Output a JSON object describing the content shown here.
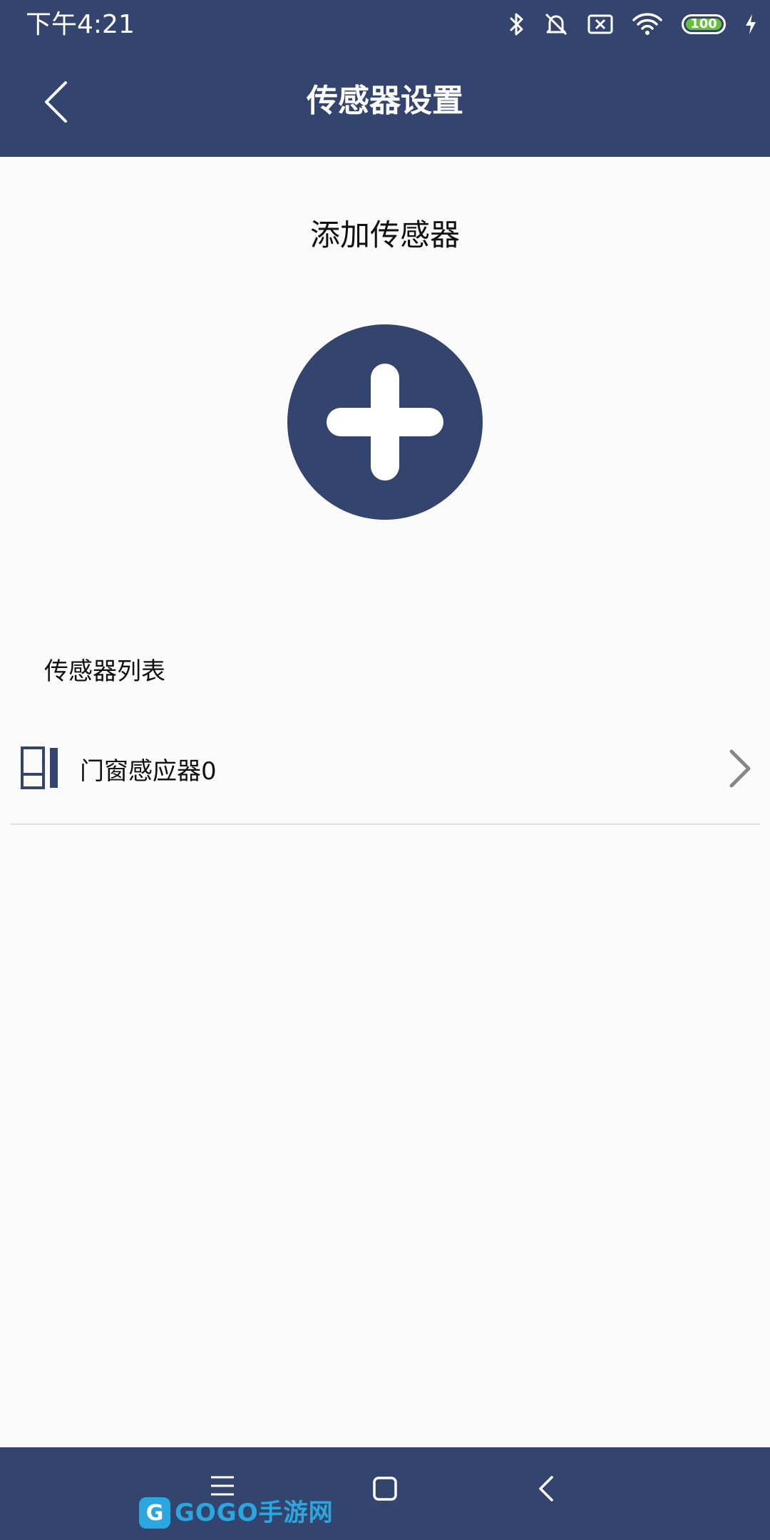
{
  "status_bar": {
    "time": "下午4:21",
    "battery": "100",
    "icons": [
      "bluetooth-icon",
      "mute-alarm-icon",
      "no-sim-icon",
      "wifi-icon",
      "battery-icon",
      "charging-icon"
    ]
  },
  "header": {
    "title": "传感器设置",
    "back_icon": "chevron-left-icon"
  },
  "add_section": {
    "title": "添加传感器",
    "button_icon": "plus-icon"
  },
  "list_section": {
    "title": "传感器列表",
    "items": [
      {
        "label": "门窗感应器0",
        "icon": "door-window-sensor-icon"
      }
    ]
  },
  "nav_bar": {
    "icons": [
      "menu-icon",
      "home-icon",
      "back-icon"
    ]
  },
  "watermark": {
    "text": "GOGO手游网"
  },
  "colors": {
    "primary": "#33446f",
    "background": "#fbfbfb",
    "divider": "#e2e2e2",
    "battery": "#63c23a"
  }
}
